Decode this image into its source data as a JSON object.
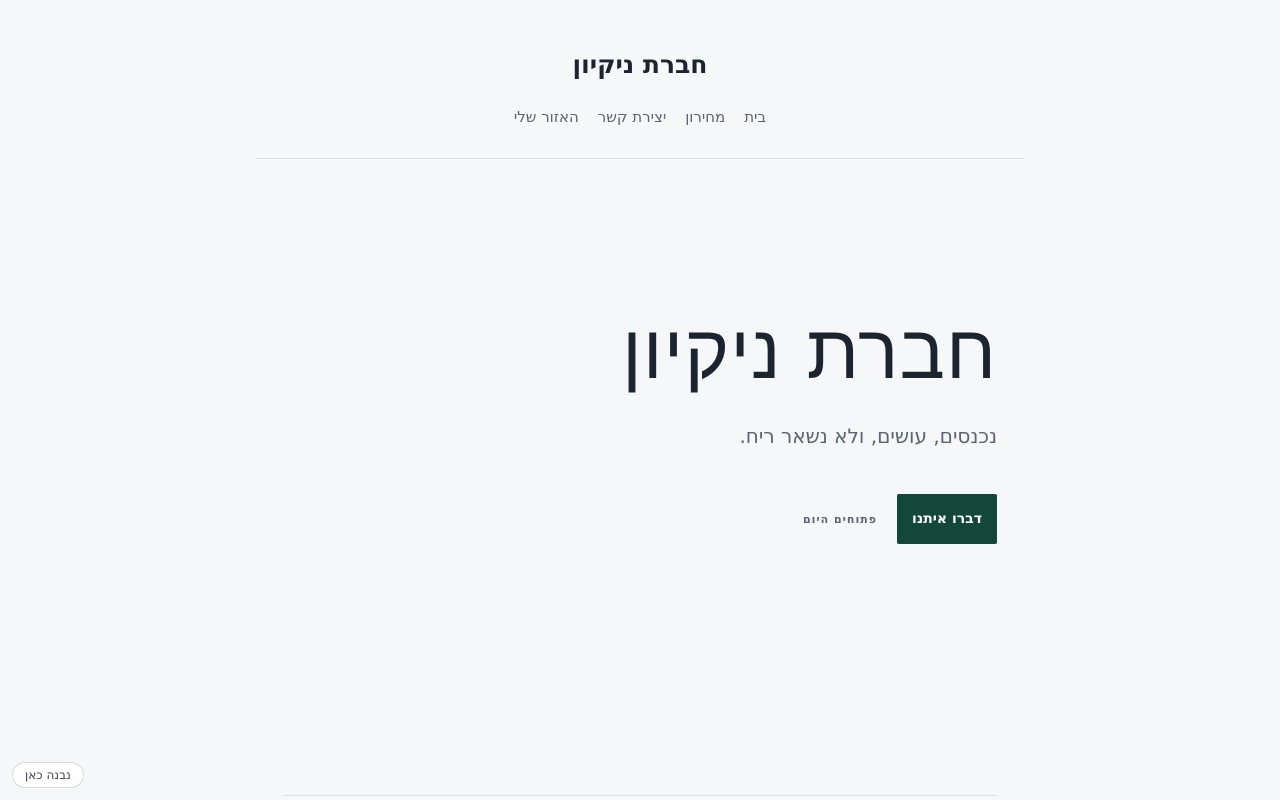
{
  "header": {
    "brand": "חברת ניקיון",
    "nav": [
      "בית",
      "מחירון",
      "יצירת קשר",
      "האזור שלי"
    ]
  },
  "hero": {
    "title": "חברת ניקיון",
    "subtitle": "נכנסים, עושים, ולא נשאר ריח.",
    "primary_cta": "דברו איתנו",
    "secondary_cta": "פתוחים היום"
  },
  "badge": {
    "label": "נבנה כאן"
  },
  "colors": {
    "background": "#f6f7f9",
    "primary_button": "#12473a",
    "text": "#1c2430",
    "muted_text": "#5b6472"
  }
}
